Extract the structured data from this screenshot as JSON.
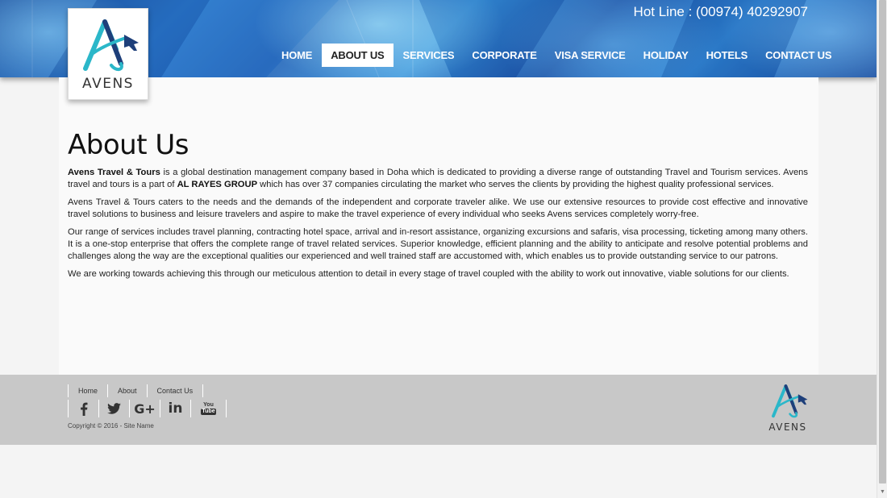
{
  "header": {
    "hotline": "Hot Line : (00974) 40292907",
    "nav": [
      {
        "label": "HOME"
      },
      {
        "label": "ABOUT US"
      },
      {
        "label": "SERVICES"
      },
      {
        "label": "CORPORATE"
      },
      {
        "label": "VISA SERVICE"
      },
      {
        "label": "HOLIDAY"
      },
      {
        "label": "HOTELS"
      },
      {
        "label": "CONTACT US"
      }
    ],
    "active_nav": "ABOUT US",
    "logo_text": "AVENS"
  },
  "main": {
    "title": "About Us",
    "p1": {
      "company": "Avens Travel & Tours",
      "part1": " is a global destination management company based in Doha which is dedicated to providing a diverse range of outstanding Travel and Tourism services. Avens travel and tours is a part of ",
      "group": "AL RAYES GROUP",
      "part2": " which has over 37 companies circulating the market who serves the clients by providing the highest quality professional services."
    },
    "p2": "Avens Travel & Tours caters to the needs and the demands of the independent and corporate traveler alike. We use our extensive resources to provide cost effective and innovative travel solutions to business and leisure travelers and aspire to make the travel experience of every individual who seeks Avens services completely worry-free.",
    "p3": "Our range of services includes travel planning, contracting hotel space, arrival and in-resort assistance, organizing excursions and safaris, visa processing, ticketing among many others. It is a one-stop enterprise that offers the complete range of travel related services. Superior knowledge, efficient planning and the ability to anticipate and resolve potential problems and challenges along the way are the exceptional qualities our experienced and well trained staff are accustomed with, which enables us to provide outstanding service to our patrons.",
    "p4": "We are working towards achieving this through our meticulous attention to detail in every stage of travel coupled with the ability to work out innovative, viable solutions for our clients."
  },
  "footer": {
    "links": [
      {
        "label": "Home"
      },
      {
        "label": "About"
      },
      {
        "label": "Contact Us"
      }
    ],
    "social": [
      {
        "icon": "facebook-icon"
      },
      {
        "icon": "twitter-icon"
      },
      {
        "icon": "google-plus-icon",
        "glyph": "G+"
      },
      {
        "icon": "linkedin-icon",
        "glyph": "in"
      },
      {
        "icon": "youtube-icon",
        "glyph_top": "You",
        "glyph_bottom": "Tube"
      }
    ],
    "copyright": "Copyright © 2016 - Site Name",
    "logo_text": "AVENS"
  },
  "colors": {
    "brand_teal": "#2bb7c9",
    "brand_navy": "#1e3f7a",
    "header_blue": "#2a76c9",
    "footer_gray": "#c8c8c8"
  }
}
